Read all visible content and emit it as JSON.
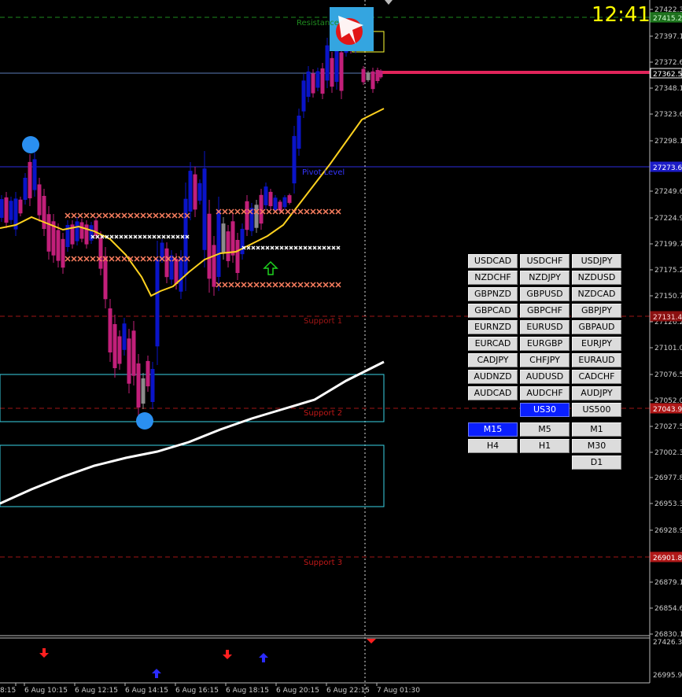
{
  "clock": "12:41",
  "levels": {
    "resistance": "Resistance",
    "pivot": "Pivot Level",
    "support1": "Support 1",
    "support2": "Support 2",
    "support3": "Support 3"
  },
  "price_axis": [
    "27422.3",
    "27397.1",
    "27372.6",
    "27348.1",
    "27323.6",
    "27298.1",
    "27249.6",
    "27224.9",
    "27199.7",
    "27175.2",
    "27150.7",
    "27126.2",
    "27101.0",
    "27076.5",
    "27052.0",
    "27027.5",
    "27002.3",
    "26977.8",
    "26953.3",
    "26928.9",
    "26904.1",
    "26879.1",
    "26854.6",
    "26830.1"
  ],
  "price_tags": {
    "current": "27362.5",
    "resistance": "27415.2",
    "pivot": "27273.6",
    "support1": "27131.4",
    "support2": "27043.9",
    "support3": "26901.8"
  },
  "sub_axis": [
    "27426.35",
    "26995.93"
  ],
  "time_axis": [
    "8:15",
    "6 Aug 10:15",
    "6 Aug 12:15",
    "6 Aug 14:15",
    "6 Aug 16:15",
    "6 Aug 18:15",
    "6 Aug 20:15",
    "6 Aug 22:15",
    "7 Aug 01:30"
  ],
  "symbols": [
    "USDCAD",
    "USDCHF",
    "USDJPY",
    "NZDCHF",
    "NZDJPY",
    "NZDUSD",
    "GBPNZD",
    "GBPUSD",
    "NZDCAD",
    "GBPCAD",
    "GBPCHF",
    "GBPJPY",
    "EURNZD",
    "EURUSD",
    "GBPAUD",
    "EURCAD",
    "EURGBP",
    "EURJPY",
    "CADJPY",
    "CHFJPY",
    "EURAUD",
    "AUDNZD",
    "AUDUSD",
    "CADCHF",
    "AUDCAD",
    "AUDCHF",
    "AUDJPY"
  ],
  "indices": [
    "US30",
    "US500"
  ],
  "active_index": "US30",
  "timeframes": [
    "M15",
    "M5",
    "M1",
    "H4",
    "H1",
    "M30",
    "D1"
  ],
  "active_timeframe": "M15",
  "colors": {
    "bull": "#0a14c8",
    "bear": "#c21f7a",
    "neutral": "#8c8c8c",
    "ma_fast": "#ffd21f",
    "ma_slow": "#ffffff",
    "zone": "#3ad4e6",
    "pivot": "#2b2bdf",
    "support": "#c01818",
    "resistance": "#1e8a1e",
    "current": "#e0245a",
    "clock": "#ffff00"
  }
}
